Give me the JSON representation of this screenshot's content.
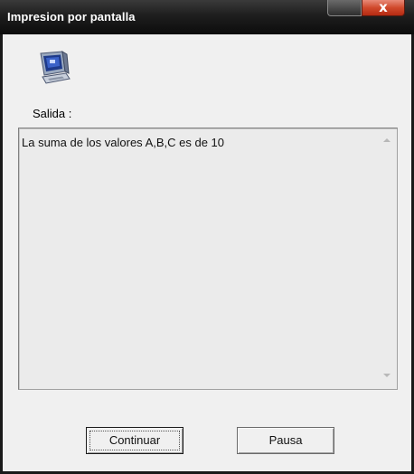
{
  "window": {
    "title": "Impresion por pantalla",
    "close_glyph": "x",
    "close_icon": "close-icon",
    "app_icon": "computer-monitor-icon"
  },
  "content": {
    "output_label": "Salida :",
    "output_lines": [
      "La suma de los valores A,B,C es de 10"
    ]
  },
  "buttons": {
    "continue_label": "Continuar",
    "pause_label": "Pausa"
  },
  "colors": {
    "titlebar": "#1e1e1e",
    "close_button": "#d04a2c",
    "client_background": "#f0f0f0",
    "output_background": "#ebebeb"
  }
}
